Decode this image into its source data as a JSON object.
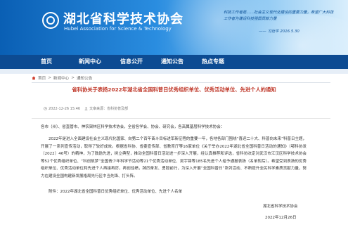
{
  "header": {
    "title": "湖北省科学技术协会",
    "subtitle": "Hubei Association for Science & Technology",
    "quote": "科技工作者是……社会主义现代化建设的重要力量，希望广大科技工作者为建设科技强国贡献力量",
    "quote_sign": "—— 习近平  2016.5.30"
  },
  "nav": {
    "items": [
      "首页",
      "新闻中心",
      "信息公开",
      "通知公告",
      "热点专题"
    ]
  },
  "breadcrumb": {
    "items": [
      "首页",
      "新闻中心",
      "通知公告"
    ],
    "separator": ">"
  },
  "article": {
    "title": "省科协关于表扬2022年湖北省全国科普日优秀组织单位、优秀活动单位、先进个人的通知",
    "date": "2022-12-26 15:46",
    "source": "文章来源：省科协普及部",
    "salutation": "各市（州）、省直管市、神农架林区科学技术协会，全省各学会、协会、研究会，各高属基层科学技术协会：",
    "body": "2022年是进入全面建设社会主义现代化国家、向第二个百年奋斗目标进军新征程的重要一年，各地各部门围绕“喜迎二十大、科普向未来”科普日主题，开展了一系列宣传活动，取得了较好成效。根据省科协、省委宣传部、省教育厅等16家单位《关于举办2022年湖北省全国科普日活动的通知》（鄂科协发〔2022〕46号）的精神，为了鼓励先进，树立典型，推动全国科普日活动进一步深入开展，经认真推荐和评选，省科协决定对武汉市江汉区科学技术协会等52个优秀组织单位、“科创筑梦”全国青少年科学节活动等21个优秀活动单位、吴宇锦等185名先进个人给予通报表扬（名单附后）。希望受到表扬的优秀组织单位、优秀活动单位和先进个人再接再厉，再创佳绩，踔厉奋发、勇毅前行，为深入开展“全国科普日”系列活动、不断提升全民科学素质贡献力量，努力在建设全国构建新发展格局先行区中当先锋、打头阵。",
    "attachment": "附件：2022年湖北省全国科普日优秀组织单位、优秀活动单位、先进个人名单",
    "signature_org": "湖北省科学技术协会",
    "signature_date": "2022年12月26日"
  },
  "colors": {
    "nav_bg": "#0d4b92",
    "title_red": "#c0392b",
    "banner_blue": "#0a5fb4"
  }
}
